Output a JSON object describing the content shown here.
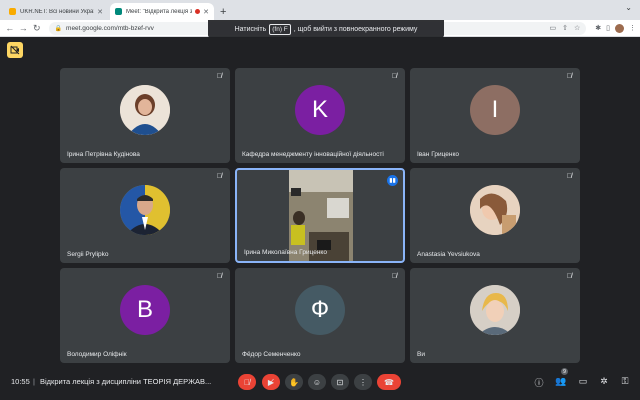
{
  "browser": {
    "tabs": [
      {
        "title": "UKR.NET: Всі новини України...",
        "favicon_color": "#f9ab00",
        "active": false
      },
      {
        "title": "Meet: \"Відкрита лекція з д...",
        "favicon_color": "#00897b",
        "active": true,
        "recording": true
      }
    ],
    "new_tab_label": "+",
    "url": "meet.google.com/mtb-bzef-rvv",
    "fullscreen_hint": {
      "before": "Натисніть",
      "key": "(fn) F",
      "after": ", щоб вийти з повноекранного режиму"
    }
  },
  "participants": [
    {
      "name": "Ірина Петрівна Кудінова",
      "type": "photo",
      "avatar_color": "#d9c3b0",
      "muted": true
    },
    {
      "name": "Кафедра менеджменту інноваційної діяльності",
      "type": "letter",
      "letter": "K",
      "avatar_color": "#7b1fa2",
      "muted": true
    },
    {
      "name": "Іван Гриценко",
      "type": "letter",
      "letter": "I",
      "avatar_color": "#8d6e63",
      "muted": true
    },
    {
      "name": "Sergii Prylipko",
      "type": "photo",
      "avatar_color": "#b0a040",
      "muted": true
    },
    {
      "name": "Ірина Миколаївна Гриценко",
      "type": "video",
      "muted": false,
      "speaking": true
    },
    {
      "name": "Anastasia Yevsiukova",
      "type": "photo",
      "avatar_color": "#c9a589",
      "muted": true
    },
    {
      "name": "Володимир Оліфнік",
      "type": "letter",
      "letter": "B",
      "avatar_color": "#7b1fa2",
      "muted": true
    },
    {
      "name": "Фёдор Семенченко",
      "type": "letter",
      "letter": "Ф",
      "avatar_color": "#455a64",
      "muted": true
    },
    {
      "name": "Ви",
      "type": "photo",
      "avatar_color": "#b8b0a8",
      "muted": true
    }
  ],
  "meeting": {
    "time": "10:55",
    "separator": "|",
    "title": "Відкрита лекція з дисципліни ТЕОРІЯ ДЕРЖАВ...",
    "participant_count": "9"
  },
  "colors": {
    "accent": "#8ab4f8",
    "danger": "#ea4335",
    "highlight": "#fdd663"
  }
}
